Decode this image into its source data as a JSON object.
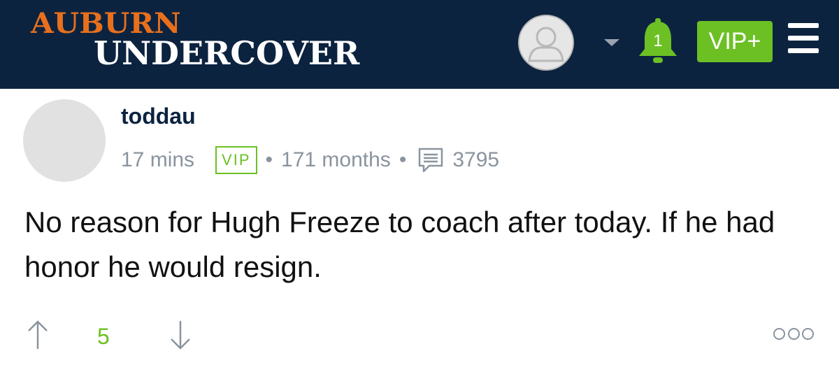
{
  "header": {
    "logo_line1": "AUBURN",
    "logo_line2": "UNDERCOVER",
    "notification_count": "1",
    "vip_plus_label": "VIP+",
    "colors": {
      "bar": "#0c2340",
      "logo_orange": "#e8701c",
      "accent_green": "#6cc024"
    },
    "icons": [
      "user-avatar-icon",
      "chevron-down-icon",
      "bell-icon",
      "menu-icon"
    ]
  },
  "post": {
    "username": "toddau",
    "time": "17 mins",
    "badge": "VIP",
    "membership": "171 months",
    "post_count": "3795",
    "body": "No reason for Hugh Freeze to coach after today. If he had honor he would resign.",
    "score": "5",
    "icons": [
      "comment-icon",
      "arrow-up-icon",
      "arrow-down-icon",
      "more-options-icon"
    ]
  }
}
